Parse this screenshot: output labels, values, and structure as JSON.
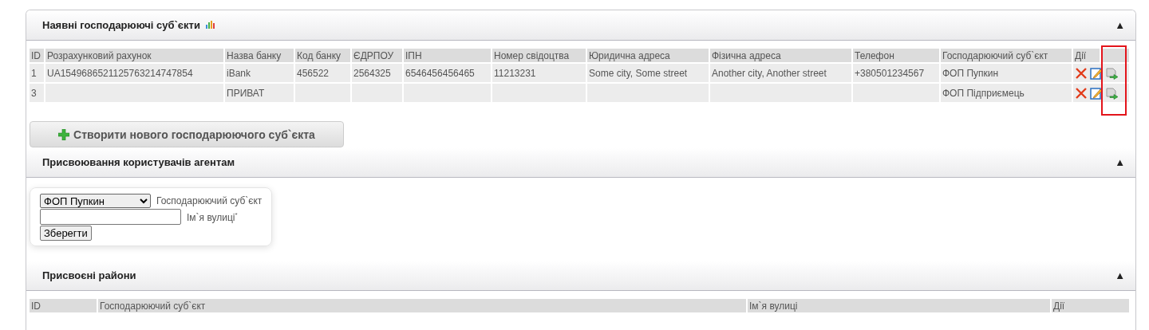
{
  "sections": [
    {
      "kind": "table",
      "title": "Наявні господарюючі суб`єкти",
      "toggle": "▲",
      "chart_icon": true,
      "table": {
        "columns": [
          "ID",
          "Розрахунковий рахунок",
          "Назва банку",
          "Код банку",
          "ЄДРПОУ",
          "ІПН",
          "Номер свідоцтва",
          "Юридична адреса",
          "Фізична адреса",
          "Телефон",
          "Господарюючий суб`єкт",
          "Дії"
        ],
        "rows": [
          {
            "cells": [
              "1",
              "UA1549686521125763214747854",
              "iBank",
              "456522",
              "2564325",
              "6546456456465",
              "11213231",
              "Some city, Some street",
              "Another city, Another street",
              "+380501234567",
              "ФОП Пупкин"
            ]
          },
          {
            "cells": [
              "3",
              "",
              "ПРИВАТ",
              "",
              "",
              "",
              "",
              "",
              "",
              "",
              "ФОП Підприємець"
            ]
          }
        ]
      },
      "annotation": {
        "kind": "frame"
      },
      "create_button": "Створити нового господарюючого суб`єкта"
    },
    {
      "kind": "form",
      "title": "Присвоювання користувачів агентам",
      "toggle": "▲",
      "fields": [
        {
          "kind": "select",
          "value": "ФОП Пупкин",
          "label": "Господарюючий суб`єкт"
        },
        {
          "kind": "text",
          "label": "Ім`я вулиці$^{*}$"
        }
      ],
      "button": "Зберегти"
    },
    {
      "kind": "table",
      "title": "Присвоєні райони",
      "toggle": "▲",
      "table": {
        "columns": [
          "ID",
          "Господарюючий суб`єкт",
          "Ім`я вулиці",
          "Дії"
        ]
      }
    }
  ]
}
